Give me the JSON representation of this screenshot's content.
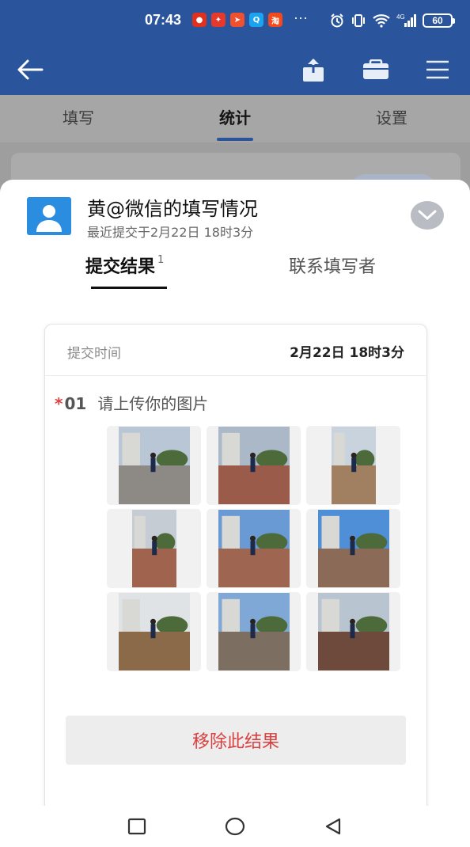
{
  "status_bar": {
    "time": "07:43",
    "more": "···",
    "battery": "60",
    "notifications": [
      {
        "icon": "app-notification-icon",
        "color": "#e0301e",
        "glyph": "●"
      },
      {
        "icon": "app-notification-icon",
        "color": "#e6392b",
        "glyph": "✦"
      },
      {
        "icon": "app-notification-icon",
        "color": "#f0502d",
        "glyph": "➤"
      },
      {
        "icon": "qq-notification-icon",
        "color": "#1aa3f0",
        "glyph": "Q"
      },
      {
        "icon": "taobao-notification-icon",
        "color": "#f24a1d",
        "glyph": "淘"
      }
    ]
  },
  "top_tabs": [
    {
      "label": "填写",
      "active": false
    },
    {
      "label": "统计",
      "active": true
    },
    {
      "label": "设置",
      "active": false
    }
  ],
  "sheet": {
    "title": "黄@微信的填写情况",
    "subtitle": "最近提交于2月22日 18时3分",
    "tab_results": "提交结果",
    "tab_results_count": "1",
    "tab_contact": "联系填写者",
    "card": {
      "submit_time_label": "提交时间",
      "submit_time_value": "2月22日 18时3分",
      "required_mark": "*",
      "question_number": "01",
      "question_text": "请上传你的图片",
      "photos": [
        {
          "sky": "#b9c6d6",
          "ground": "#8d8a86",
          "shape": "landscape"
        },
        {
          "sky": "#aab8c8",
          "ground": "#9a5b4a",
          "shape": "portrait"
        },
        {
          "sky": "#c9d3de",
          "ground": "#a08060",
          "shape": "narrow"
        },
        {
          "sky": "#c5ccd4",
          "ground": "#a0634e",
          "shape": "narrow"
        },
        {
          "sky": "#6a9ad4",
          "ground": "#9e6650",
          "shape": "portrait"
        },
        {
          "sky": "#4e8fd8",
          "ground": "#8c6a58",
          "shape": "landscape"
        },
        {
          "sky": "#dfe3e6",
          "ground": "#8a6a48",
          "shape": "landscape"
        },
        {
          "sky": "#7fa8d6",
          "ground": "#7c6e60",
          "shape": "portrait"
        },
        {
          "sky": "#b8c4d0",
          "ground": "#6e4a3c",
          "shape": "portrait"
        }
      ],
      "remove_button": "移除此结果"
    }
  },
  "colors": {
    "brand_blue": "#2a549c",
    "danger_red": "#d94040",
    "avatar_blue": "#2a8de0"
  }
}
